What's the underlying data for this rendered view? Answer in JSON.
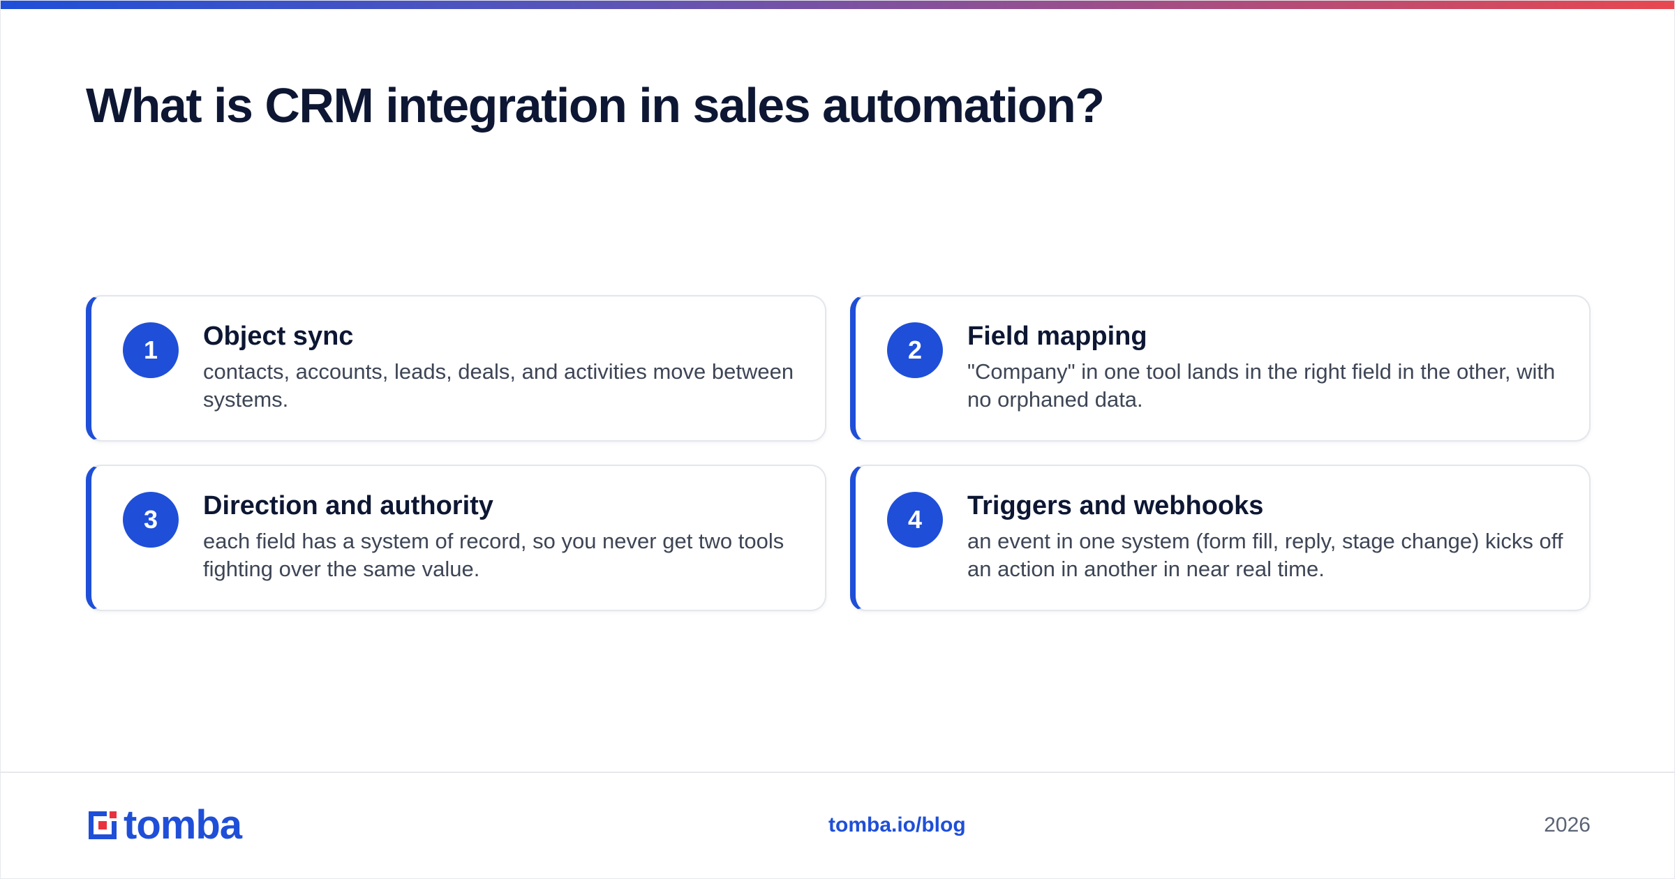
{
  "title": "What is CRM integration in sales automation?",
  "cards": [
    {
      "number": "1",
      "title": "Object sync",
      "description": "contacts, accounts, leads, deals, and activities move between systems."
    },
    {
      "number": "2",
      "title": "Field mapping",
      "description": "\"Company\" in one tool lands in the right field in the other, with no orphaned data."
    },
    {
      "number": "3",
      "title": "Direction and authority",
      "description": "each field has a system of record, so you never get two tools fighting over the same value."
    },
    {
      "number": "4",
      "title": "Triggers and webhooks",
      "description": "an event in one system (form fill, reply, stage change) kicks off an action in another in near real time."
    }
  ],
  "footer": {
    "logo_text": "tomba",
    "link": "tomba.io/blog",
    "year": "2026"
  },
  "colors": {
    "accent": "#1f4fd8",
    "logo_red": "#e8333f",
    "title": "#0d1733",
    "body_text": "#3d4555"
  },
  "icons": {
    "logo": "tomba-logo-icon"
  }
}
